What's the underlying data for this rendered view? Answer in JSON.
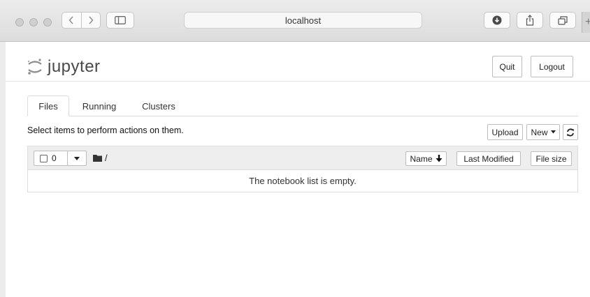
{
  "browser": {
    "url": "localhost",
    "new_tab_glyph": "+"
  },
  "header": {
    "logo_text": "jupyter",
    "quit_label": "Quit",
    "logout_label": "Logout"
  },
  "tabs": [
    {
      "label": "Files",
      "active": true
    },
    {
      "label": "Running",
      "active": false
    },
    {
      "label": "Clusters",
      "active": false
    }
  ],
  "toolbar": {
    "hint": "Select items to perform actions on them.",
    "upload_label": "Upload",
    "new_label": "New"
  },
  "list": {
    "selected_count": "0",
    "path": "/",
    "sort_name_label": "Name",
    "last_modified_label": "Last Modified",
    "file_size_label": "File size",
    "empty_message": "The notebook list is empty."
  },
  "icons": {
    "logo": "jupyter-logo-icon",
    "back": "chevron-left-icon",
    "forward": "chevron-right-icon",
    "sidebar": "sidebar-icon",
    "download": "download-icon",
    "share": "share-icon",
    "tabs": "tabs-icon",
    "refresh": "refresh-icon",
    "folder": "folder-icon",
    "sort": "arrow-down-icon",
    "caret": "caret-down-icon"
  }
}
